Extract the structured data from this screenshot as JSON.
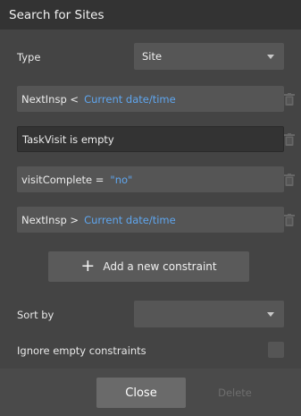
{
  "window": {
    "title": "Search for Sites"
  },
  "type_field": {
    "label": "Type",
    "value": "Site"
  },
  "constraints": [
    {
      "text": "NextInsp <",
      "dynamic_value": "Current date/time",
      "string_value": null,
      "active": false
    },
    {
      "text": "TaskVisit is empty",
      "dynamic_value": null,
      "string_value": null,
      "active": true
    },
    {
      "text": "visitComplete =",
      "dynamic_value": null,
      "string_value": "\"no\"",
      "active": false
    },
    {
      "text": "NextInsp >",
      "dynamic_value": "Current date/time",
      "string_value": null,
      "active": false
    }
  ],
  "add_constraint": {
    "label": "Add a new constraint",
    "icon": "plus-icon"
  },
  "sort_by": {
    "label": "Sort by",
    "value": ""
  },
  "ignore_empty": {
    "label": "Ignore empty constraints",
    "checked": false
  },
  "footer": {
    "close_label": "Close",
    "delete_label": "Delete"
  },
  "colors": {
    "background": "#444444",
    "titlebar": "#333333",
    "dynamic_value": "#5fa6ef",
    "field": "#555555",
    "disabled_text": "#6e6e6e"
  }
}
